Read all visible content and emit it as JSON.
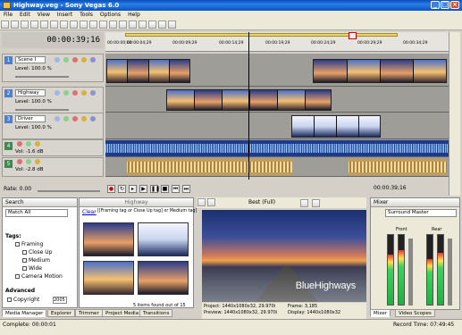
{
  "window": {
    "title": "Highway.veg - Sony Vegas 6.0"
  },
  "menu": [
    "File",
    "Edit",
    "View",
    "Insert",
    "Tools",
    "Options",
    "Help"
  ],
  "timeline": {
    "current_time": "00:00:39;16",
    "ruler_marks": [
      "00:00:00;00",
      "00:00:04;29",
      "00:00:09;29",
      "00:00:14;29",
      "00:00:19;29",
      "00:00:24;29",
      "00:00:29;29",
      "00:00:34;29"
    ],
    "rate": "Rate: 0.00"
  },
  "tracks": [
    {
      "num": "1",
      "name": "Scene I",
      "level": "Level: 100.0 %"
    },
    {
      "num": "2",
      "name": "Highway",
      "level": "Level: 100.0 %"
    },
    {
      "num": "3",
      "name": "Driver",
      "level": "Level: 100.0 %"
    },
    {
      "num": "4",
      "name": "",
      "level": "Vol:    -1.6 dB"
    },
    {
      "num": "5",
      "name": "",
      "level": "Vol:    -2.8 dB"
    }
  ],
  "end_time": "00:00:39;16",
  "media_manager": {
    "search_label": "Search",
    "match": "Match All",
    "tags_label": "Tags:",
    "tags": [
      {
        "label": "Framing",
        "checked": true
      },
      {
        "label": "Close Up",
        "checked": true
      },
      {
        "label": "Medium",
        "checked": true
      },
      {
        "label": "Wide",
        "checked": true
      },
      {
        "label": "Camera Motion",
        "checked": false
      }
    ],
    "advanced": "Advanced",
    "copyright_label": "Copyright",
    "copyright_value": "2005"
  },
  "media_pane": {
    "title": "Highway",
    "clear": "Clear",
    "query": "[[Framing tag or Close Up tag] or Medium tag]",
    "result": "5 items found out of 15"
  },
  "tabs_left": [
    "Media Manager",
    "Explorer",
    "Trimmer",
    "Project Media",
    "Transitions"
  ],
  "preview": {
    "quality": "Best (Full)",
    "overlay": "BlueHighways",
    "info": {
      "project": "Project:   1440x1080x32, 29.970i",
      "preview": "Preview:  1440x1080x32, 29.970i",
      "frame": "Frame:        3,185",
      "display": "Display:  1440x1080x32"
    }
  },
  "mixer": {
    "title": "Mixer",
    "master": "Surround Master",
    "front_label": "Front",
    "rear_label": "Rear",
    "levels": [
      0.72,
      0.78,
      0.66,
      0.74
    ],
    "readouts": [
      "-6.3",
      "-3.7",
      "0.0",
      "0.0"
    ],
    "tabs": [
      "Mixer",
      "Video Scopes"
    ]
  },
  "status": {
    "complete": "Complete: 00:00:01",
    "record": "Record Time: 07:49:45"
  }
}
